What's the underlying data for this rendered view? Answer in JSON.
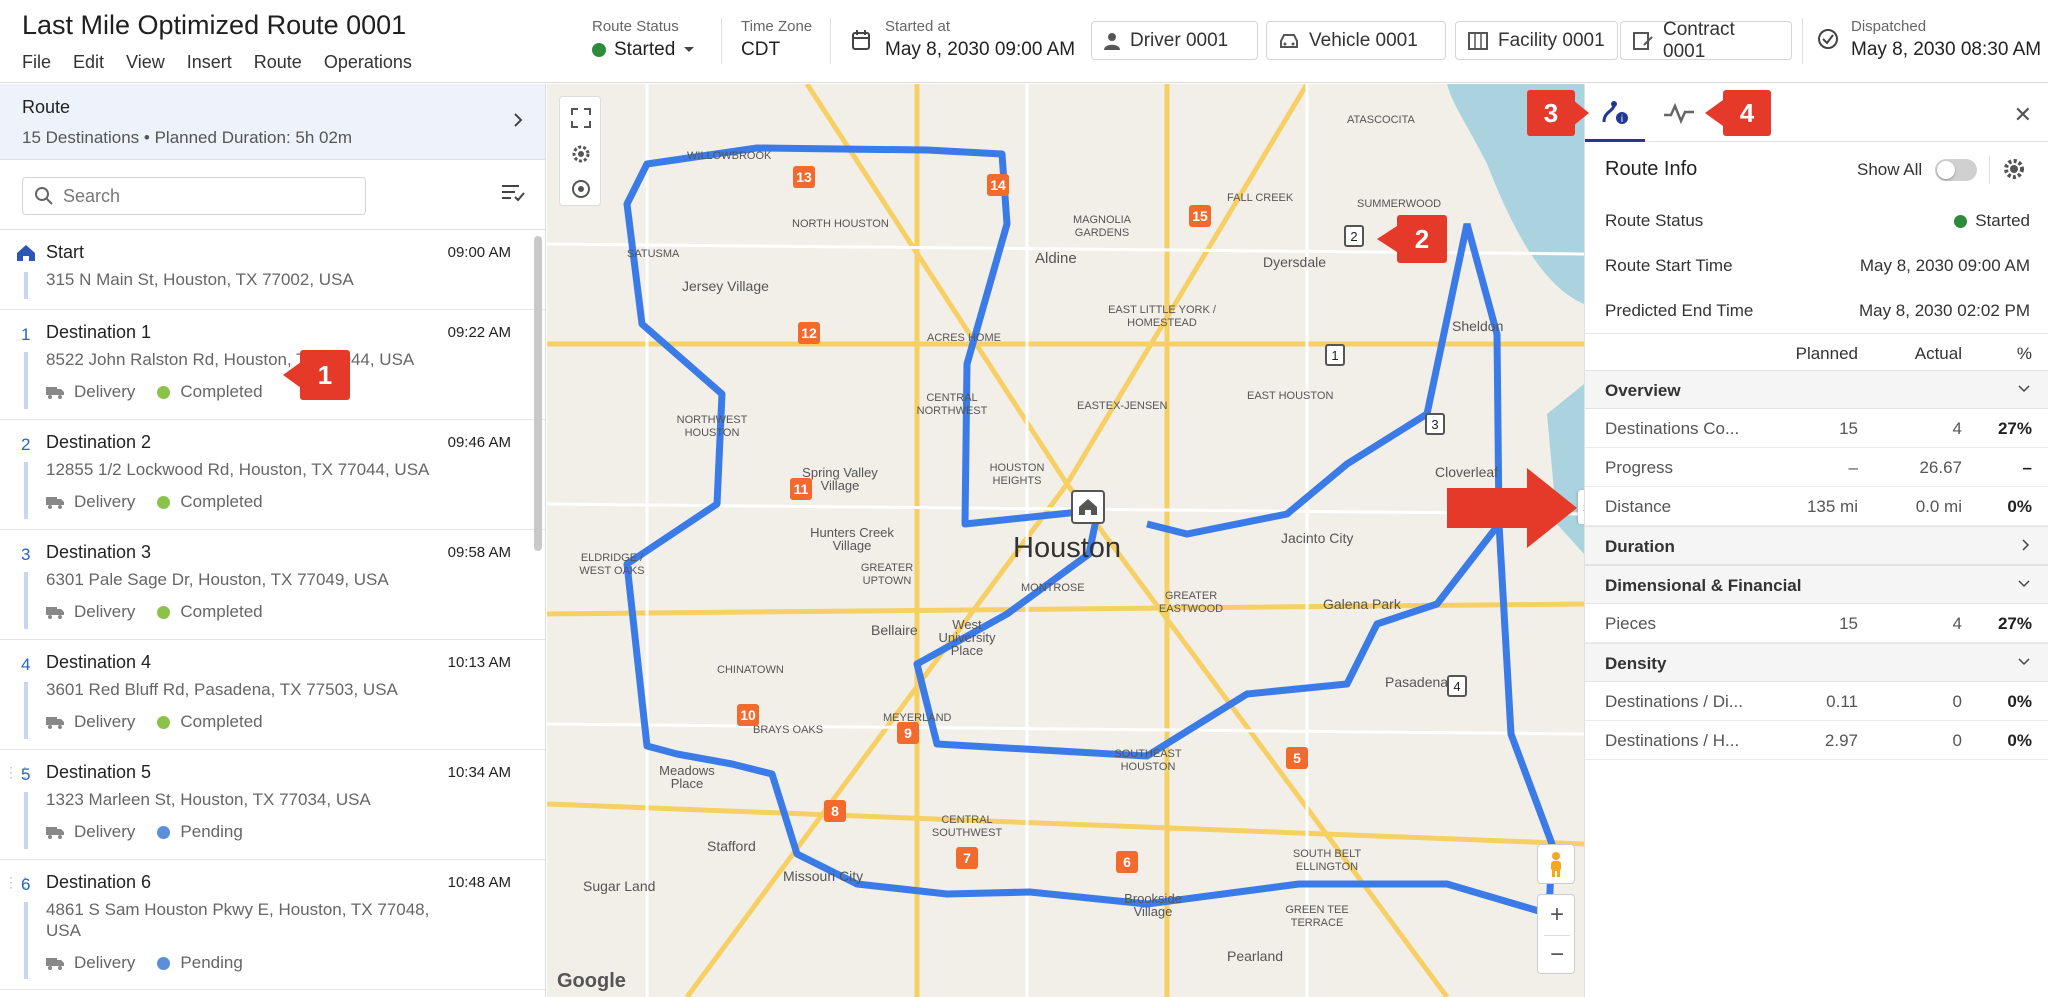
{
  "header": {
    "title": "Last Mile Optimized Route 0001",
    "menu": [
      "File",
      "Edit",
      "View",
      "Insert",
      "Route",
      "Operations"
    ],
    "route_status_label": "Route Status",
    "route_status_value": "Started",
    "timezone_label": "Time Zone",
    "timezone_value": "CDT",
    "started_label": "Started at",
    "started_value": "May 8, 2030  09:00 AM",
    "driver": "Driver 0001",
    "vehicle": "Vehicle 0001",
    "facility": "Facility 0001",
    "contract": "Contract 0001",
    "dispatched_label": "Dispatched",
    "dispatched_value": "May 8, 2030  08:30 AM"
  },
  "route_summary": {
    "title": "Route",
    "subtitle": "15 Destinations • Planned Duration: 5h 02m"
  },
  "search": {
    "placeholder": "Search"
  },
  "stops": [
    {
      "num": "",
      "name": "Start",
      "address": "315 N Main St, Houston, TX 77002, USA",
      "time": "09:00 AM"
    },
    {
      "num": "1",
      "name": "Destination 1",
      "address": "8522 John Ralston Rd, Houston, TX 77044, USA",
      "time": "09:22 AM",
      "type": "Delivery",
      "status": "Completed"
    },
    {
      "num": "2",
      "name": "Destination 2",
      "address": "12855 1/2 Lockwood Rd, Houston, TX 77044, USA",
      "time": "09:46 AM",
      "type": "Delivery",
      "status": "Completed"
    },
    {
      "num": "3",
      "name": "Destination 3",
      "address": "6301 Pale Sage Dr, Houston, TX 77049, USA",
      "time": "09:58 AM",
      "type": "Delivery",
      "status": "Completed"
    },
    {
      "num": "4",
      "name": "Destination 4",
      "address": "3601 Red Bluff Rd, Pasadena, TX 77503, USA",
      "time": "10:13 AM",
      "type": "Delivery",
      "status": "Completed"
    },
    {
      "num": "5",
      "name": "Destination 5",
      "address": "1323 Marleen St, Houston, TX 77034, USA",
      "time": "10:34 AM",
      "type": "Delivery",
      "status": "Pending"
    },
    {
      "num": "6",
      "name": "Destination 6",
      "address": "4861 S Sam Houston Pkwy E, Houston, TX 77048, USA",
      "time": "10:48 AM",
      "type": "Delivery",
      "status": "Pending"
    }
  ],
  "map": {
    "city": "Houston",
    "attribution": "Google",
    "place_labels": [
      "WILLOWBROOK",
      "NORTH HOUSTON",
      "Aldine",
      "MAGNOLIA GARDENS",
      "FALL CREEK",
      "SUMMERWOOD",
      "ATASCOCITA",
      "Jersey Village",
      "SATUSMA",
      "ACRES HOME",
      "EAST LITTLE YORK / HOMESTEAD",
      "Dyersdale",
      "Sheldon",
      "CENTRAL NORTHWEST",
      "EASTEX-JENSEN",
      "EAST HOUSTON",
      "NORTHWEST HOUSTON",
      "Spring Valley Village",
      "HOUSTON HEIGHTS",
      "Cloverleaf",
      "Jacinto City",
      "Hunters Creek Village",
      "GREATER UPTOWN",
      "MONTROSE",
      "GREATER EASTWOOD",
      "Galena Park",
      "ELDRIDGE / WEST OAKS",
      "West University Place",
      "Bellaire",
      "Pasadena",
      "CHINATOWN",
      "MEYERLAND",
      "SOUTHEAST HOUSTON",
      "BRAYS OAKS",
      "Meadows Place",
      "CENTRAL SOUTHWEST",
      "SOUTH BELT ELLINGTON",
      "Stafford",
      "Missouri City",
      "Brookside Village",
      "Sugar Land",
      "GREEN TEE TERRACE",
      "Pearland"
    ]
  },
  "callouts": [
    "1",
    "2",
    "3",
    "4"
  ],
  "route_info": {
    "title": "Route Info",
    "show_all": "Show All",
    "status_label": "Route Status",
    "status_value": "Started",
    "start_label": "Route Start Time",
    "start_value": "May 8, 2030  09:00 AM",
    "end_label": "Predicted End Time",
    "end_value": "May 8, 2030  02:02 PM",
    "col_planned": "Planned",
    "col_actual": "Actual",
    "col_pct": "%",
    "sections": {
      "overview": "Overview",
      "duration": "Duration",
      "dimensional": "Dimensional & Financial",
      "density": "Density"
    },
    "rows": {
      "destinations": {
        "name": "Destinations Co...",
        "planned": "15",
        "actual": "4",
        "pct": "27%"
      },
      "progress": {
        "name": "Progress",
        "planned": "–",
        "actual": "26.67",
        "pct": "–"
      },
      "distance": {
        "name": "Distance",
        "planned": "135 mi",
        "actual": "0.0 mi",
        "pct": "0%"
      },
      "pieces": {
        "name": "Pieces",
        "planned": "15",
        "actual": "4",
        "pct": "27%"
      },
      "dest_dist": {
        "name": "Destinations / Di...",
        "planned": "0.11",
        "actual": "0",
        "pct": "0%"
      },
      "dest_hour": {
        "name": "Destinations / H...",
        "planned": "2.97",
        "actual": "0",
        "pct": "0%"
      }
    }
  },
  "colors": {
    "accent": "#2563c9",
    "started": "#2e8b3c",
    "completed": "#8bc34a",
    "pending": "#5b8fd9",
    "marker": "#f26a2e",
    "callout": "#e5392a",
    "route": "#3b7be8"
  }
}
